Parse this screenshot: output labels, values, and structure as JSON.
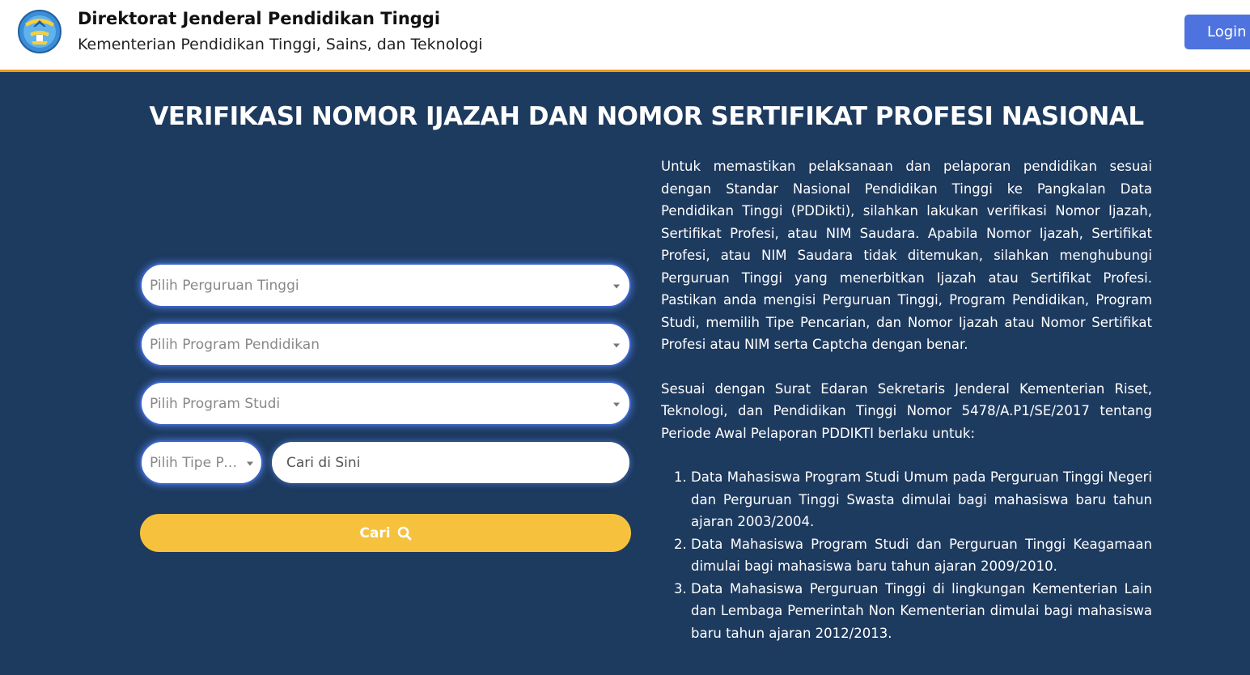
{
  "header": {
    "title": "Direktorat Jenderal Pendidikan Tinggi",
    "subtitle": "Kementerian Pendidikan Tinggi, Sains, dan Teknologi",
    "login_label": "Login"
  },
  "main": {
    "page_title": "VERIFIKASI NOMOR IJAZAH DAN NOMOR SERTIFIKAT PROFESI NASIONAL",
    "form": {
      "perguruan_tinggi_placeholder": "Pilih Perguruan Tinggi",
      "program_pendidikan_placeholder": "Pilih Program Pendidikan",
      "program_studi_placeholder": "Pilih Program Studi",
      "tipe_pencarian_placeholder": "Pilih Tipe Pencarian",
      "search_placeholder": "Cari di Sini",
      "search_value": "",
      "submit_label": "Cari"
    },
    "info": {
      "paragraph_1": "Untuk memastikan pelaksanaan dan pelaporan pendidikan sesuai dengan Standar Nasional Pendidikan Tinggi ke Pangkalan Data Pendidikan Tinggi (PDDikti), silahkan lakukan verifikasi Nomor Ijazah, Sertifikat Profesi, atau NIM Saudara. Apabila Nomor Ijazah, Sertifikat Profesi, atau NIM Saudara tidak ditemukan, silahkan menghubungi Perguruan Tinggi yang menerbitkan Ijazah atau Sertifikat Profesi. Pastikan anda mengisi Perguruan Tinggi, Program Pendidikan, Program Studi, memilih Tipe Pencarian, dan Nomor Ijazah atau Nomor Sertifikat Profesi atau NIM serta Captcha dengan benar.",
      "paragraph_2": "Sesuai dengan Surat Edaran Sekretaris Jenderal Kementerian Riset, Teknologi, dan Pendidikan Tinggi Nomor 5478/A.P1/SE/2017 tentang Periode Awal Pelaporan PDDIKTI berlaku untuk:",
      "list": [
        "Data Mahasiswa Program Studi Umum pada Perguruan Tinggi Negeri dan Perguruan Tinggi Swasta dimulai bagi mahasiswa baru tahun ajaran 2003/2004.",
        "Data Mahasiswa Program Studi dan Perguruan Tinggi Keagamaan dimulai bagi mahasiswa baru tahun ajaran 2009/2010.",
        "Data Mahasiswa Perguruan Tinggi di lingkungan Kementerian Lain dan Lembaga Pemerintah Non Kementerian dimulai bagi mahasiswa baru tahun ajaran 2012/2013."
      ]
    }
  },
  "icons": {
    "logo": "tut-wuri-handayani-logo",
    "search": "search-icon",
    "dropdown": "caret-down-icon"
  },
  "colors": {
    "header_bg": "#ffffff",
    "header_border": "#f39c12",
    "main_bg": "#1d3a5f",
    "login_button": "#4e73df",
    "submit_button": "#f6c23e"
  }
}
